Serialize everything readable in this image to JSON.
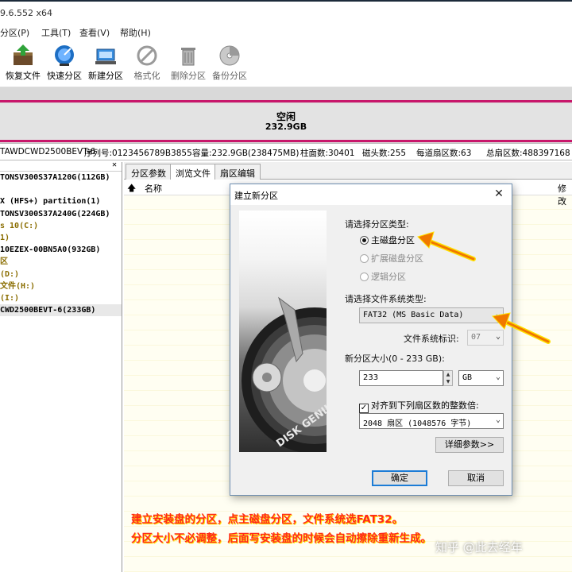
{
  "window": {
    "title_fragment": "9.6.552 x64"
  },
  "menu": [
    "分区(P)",
    "工具(T)",
    "查看(V)",
    "帮助(H)"
  ],
  "toolbar": [
    {
      "label": "恢复文件",
      "icon": "recover-files-icon"
    },
    {
      "label": "快速分区",
      "icon": "quick-partition-icon"
    },
    {
      "label": "新建分区",
      "icon": "new-partition-icon"
    },
    {
      "label": "格式化",
      "icon": "format-icon"
    },
    {
      "label": "删除分区",
      "icon": "delete-partition-icon"
    },
    {
      "label": "备份分区",
      "icon": "backup-partition-icon"
    }
  ],
  "disk_map": {
    "label": "空闲",
    "size": "232.9GB"
  },
  "disk_info": {
    "model": "TAWDCWD2500BEVT-6",
    "serial": "序列号:0123456789B3855",
    "capacity": "容量:232.9GB(238475MB)",
    "cylinders": "柱面数:30401",
    "heads": "磁头数:255",
    "sectors_per_track": "每道扇区数:63",
    "total_sectors": "总扇区数:488397168"
  },
  "tree": [
    {
      "text": "TONSV300S37A120G(112GB)",
      "kind": "disk"
    },
    {
      "text": "",
      "kind": "blank"
    },
    {
      "text": "X (HFS+) partition(1)",
      "kind": "disk"
    },
    {
      "text": "TONSV300S37A240G(224GB)",
      "kind": "disk"
    },
    {
      "text": "s 10(C:)",
      "kind": "part"
    },
    {
      "text": "1)",
      "kind": "part"
    },
    {
      "text": "10EZEX-00BN5A0(932GB)",
      "kind": "disk"
    },
    {
      "text": "区",
      "kind": "part"
    },
    {
      "text": "(D:)",
      "kind": "part"
    },
    {
      "text": "文件(H:)",
      "kind": "part"
    },
    {
      "text": "(I:)",
      "kind": "part"
    },
    {
      "text": "CWD2500BEVT-6(233GB)",
      "kind": "sel"
    }
  ],
  "tabs": [
    "分区参数",
    "浏览文件",
    "扇区编辑"
  ],
  "file_columns": {
    "name": "名称",
    "modified": "修改"
  },
  "dialog": {
    "title": "建立新分区",
    "partition_type_label": "请选择分区类型:",
    "types": [
      {
        "label": "主磁盘分区",
        "selected": true,
        "enabled": true
      },
      {
        "label": "扩展磁盘分区",
        "selected": false,
        "enabled": false
      },
      {
        "label": "逻辑分区",
        "selected": false,
        "enabled": false
      }
    ],
    "fs_label": "请选择文件系统类型:",
    "fs_value": "FAT32 (MS Basic Data)",
    "fs_id_label": "文件系统标识:",
    "fs_id_value": "07",
    "size_label": "新分区大小(0 - 233 GB):",
    "size_value": "233",
    "size_unit": "GB",
    "align_label": "对齐到下列扇区数的整数倍:",
    "align_checked": true,
    "align_value": "2048 扇区 (1048576 字节)",
    "details_button": "详细参数>>",
    "ok_button": "确定",
    "cancel_button": "取消",
    "image_text": "DISK GENIUS"
  },
  "caption": [
    "建立安装盘的分区，点主磁盘分区，文件系统选FAT32。",
    "分区大小不必调整，后面写安装盘的时候会自动擦除重新生成。"
  ],
  "watermark": "知乎 @此去经年",
  "colors": {
    "highlight_bar": "#c8176b",
    "caption": "#ff2a1a",
    "arrow": "#f07800"
  }
}
